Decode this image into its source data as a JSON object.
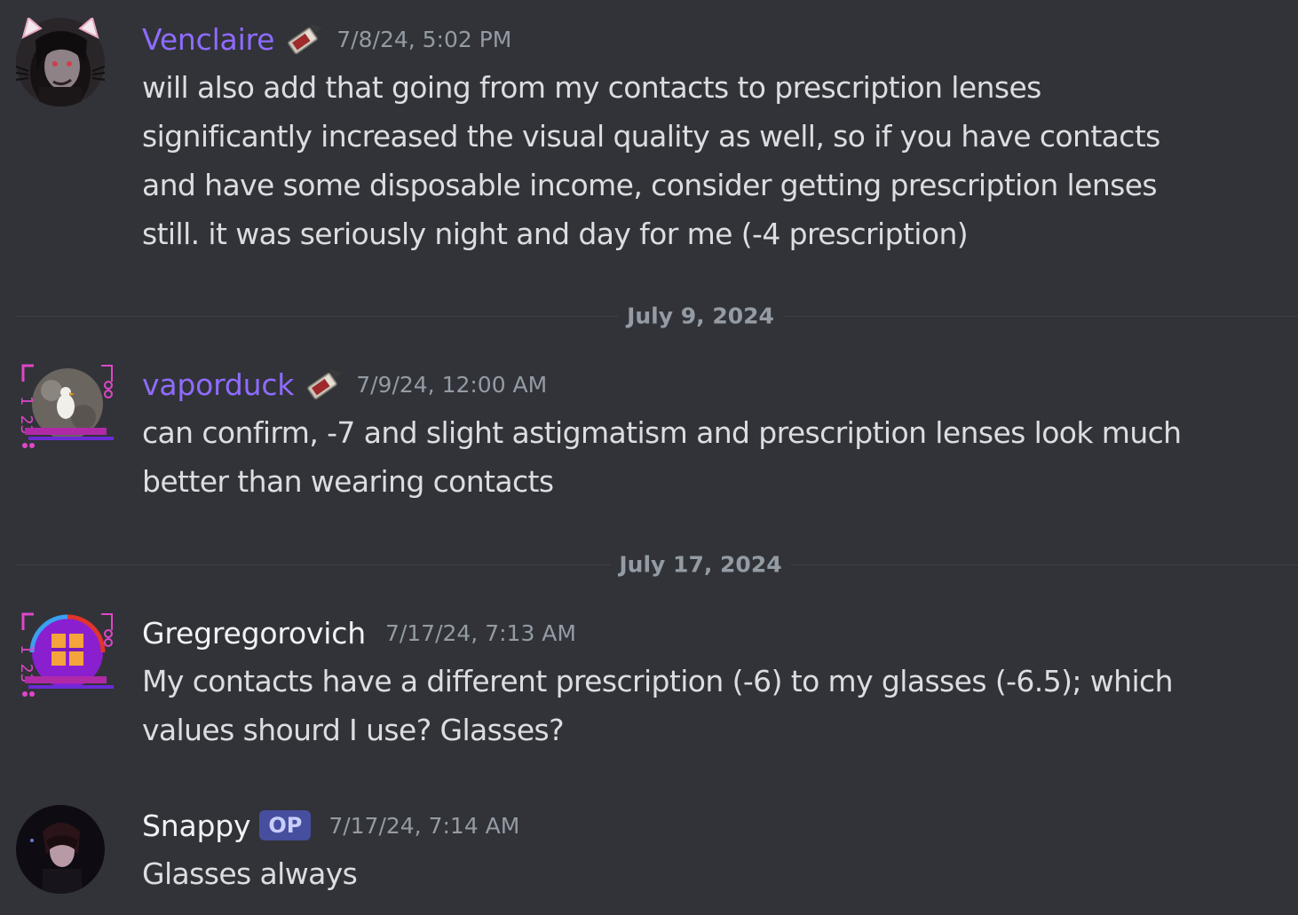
{
  "colors": {
    "background": "#313338",
    "username_purple": "#8f6bff",
    "username_white": "#f2f3f5",
    "timestamp": "#949ba4",
    "text": "#dbdee1",
    "op_tag": "#5865f2"
  },
  "messages": [
    {
      "author": "Venclaire",
      "author_color": "#8f6bff",
      "has_badge": true,
      "badge_icon": "ticket-badge-icon",
      "timestamp": "7/8/24, 5:02 PM",
      "lines": [
        "will also add that going from my contacts to prescription lenses",
        "significantly increased the visual quality as well, so if you have contacts",
        "and have some disposable income, consider getting prescription lenses",
        "still. it was seriously night and day for me (-4 prescription)"
      ]
    },
    {
      "author": "vaporduck",
      "author_color": "#8f6bff",
      "has_badge": true,
      "badge_icon": "ticket-badge-icon",
      "timestamp": "7/9/24, 12:00 AM",
      "lines": [
        "can confirm, -7 and slight astigmatism and prescription lenses look much",
        "better than wearing contacts"
      ]
    },
    {
      "author": "Gregregorovich",
      "author_color": "#f2f3f5",
      "has_badge": false,
      "timestamp": "7/17/24, 7:13 AM",
      "lines": [
        "My contacts have a different prescription (-6) to my glasses (-6.5); which",
        "values shourd I use? Glasses?"
      ]
    },
    {
      "author": "Snappy",
      "author_color": "#f2f3f5",
      "has_badge": false,
      "op_tag": "OP",
      "timestamp": "7/17/24, 7:14 AM",
      "lines": [
        "Glasses always"
      ]
    }
  ],
  "dividers": [
    {
      "label": "July 9, 2024"
    },
    {
      "label": "July 17, 2024"
    }
  ]
}
